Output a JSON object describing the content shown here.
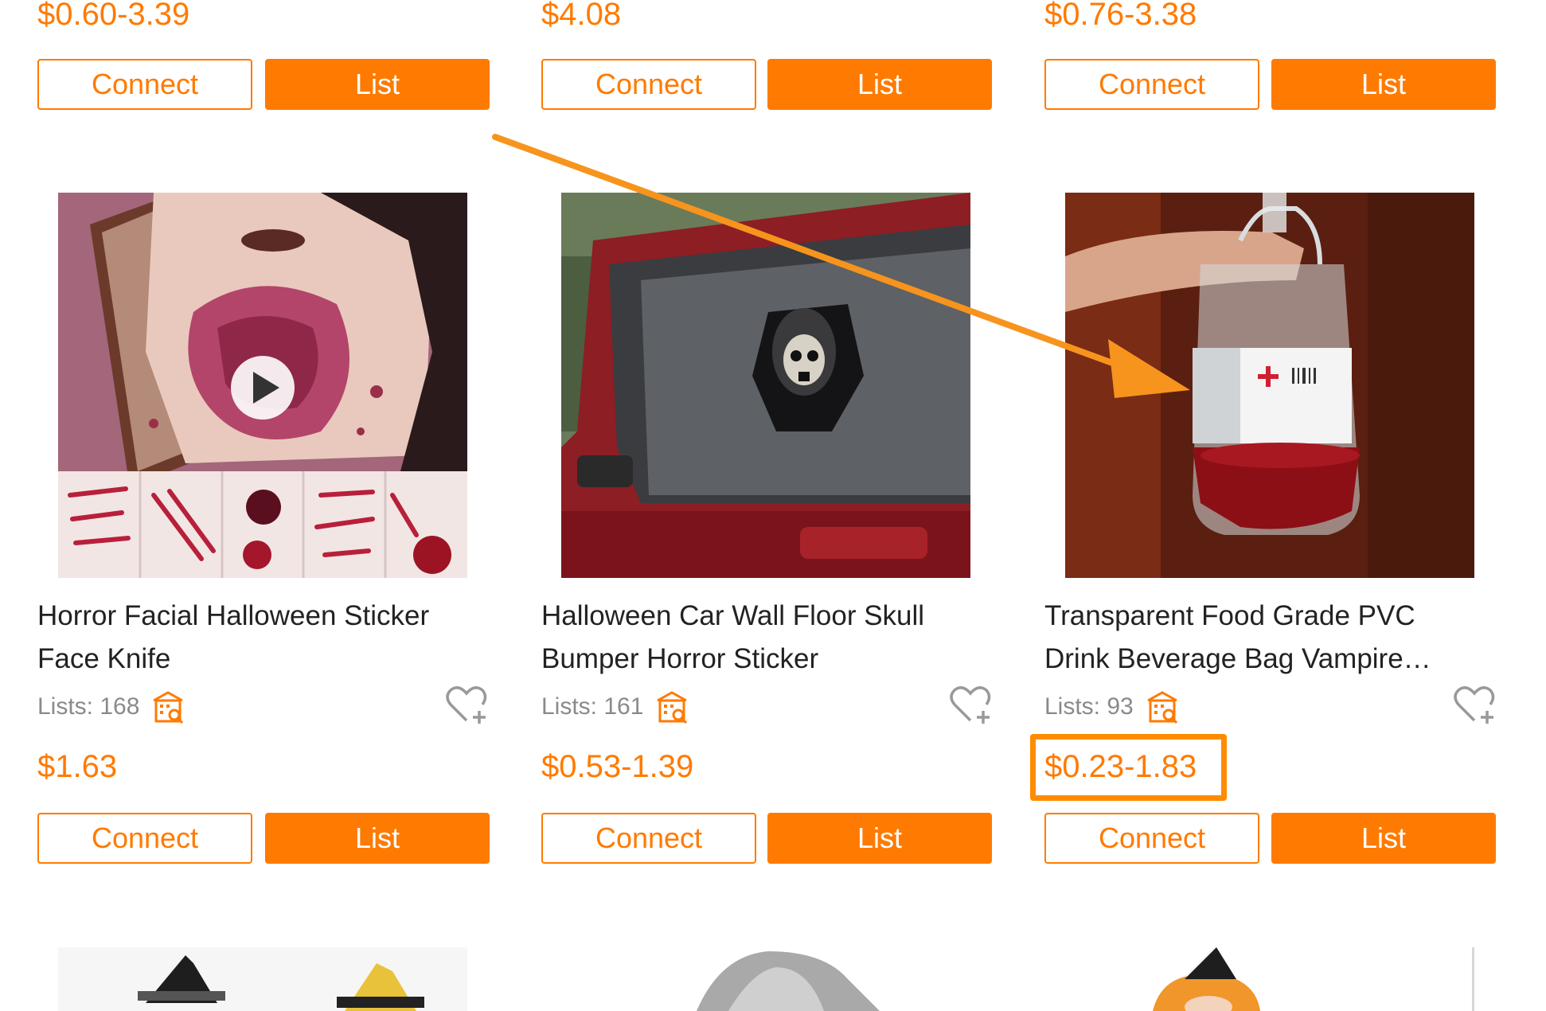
{
  "top_row": {
    "prices": [
      "$0.60-3.39",
      "$4.08",
      "$0.76-3.38"
    ]
  },
  "buttons": {
    "connect_label": "Connect",
    "list_label": "List"
  },
  "products": [
    {
      "title_line1": "Horror Facial Halloween Sticker",
      "title_line2": "Face Knife",
      "lists_text": "Lists: 168",
      "price": "$1.63",
      "has_video": true
    },
    {
      "title_line1": "Halloween Car Wall Floor Skull",
      "title_line2": "Bumper Horror Sticker",
      "lists_text": "Lists: 161",
      "price": "$0.53-1.39"
    },
    {
      "title_line1": "Transparent Food Grade PVC",
      "title_line2": "Drink Beverage Bag Vampire…",
      "lists_text": "Lists: 93",
      "price": "$0.23-1.83",
      "highlighted": true
    }
  ],
  "icons": {
    "shop": "shop-search-icon",
    "favorite": "heart-plus-icon",
    "play": "play-icon"
  },
  "colors": {
    "accent": "#ff7a00",
    "annotation": "#f7941d",
    "text": "#222222",
    "muted": "#8a8a8a"
  }
}
